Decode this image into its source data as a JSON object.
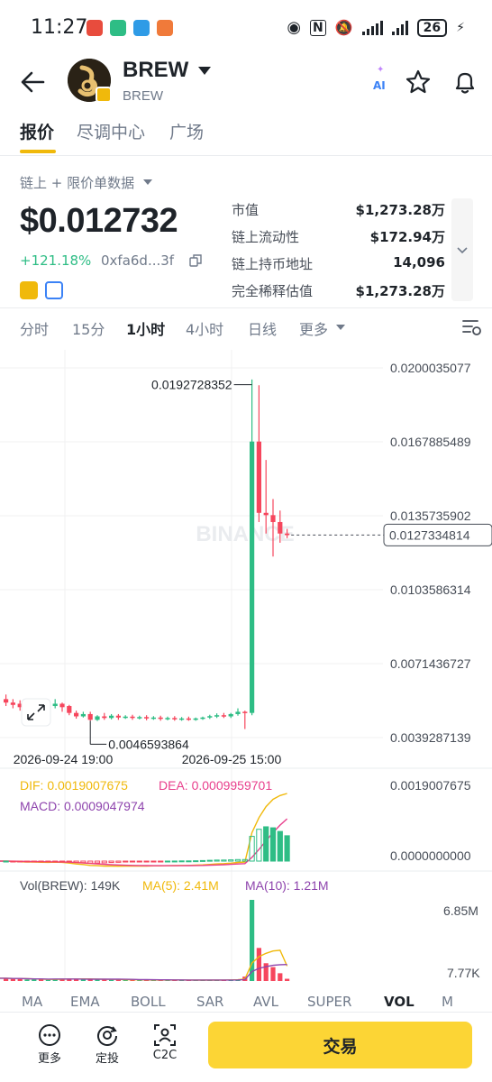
{
  "status_bar": {
    "time": "11:27",
    "battery": "26"
  },
  "header": {
    "title": "BREW",
    "subtitle": "BREW",
    "ai_label": "AI"
  },
  "tabs": [
    {
      "label": "报价"
    },
    {
      "label": "尽调中心"
    },
    {
      "label": "广场"
    }
  ],
  "info": {
    "data_source": "链上 + 限价单数据",
    "price": "$0.012732",
    "change": "+121.18%",
    "address": "0xfa6d...3f",
    "stats": [
      {
        "label": "市值",
        "value": "$1,273.28万"
      },
      {
        "label": "链上流动性",
        "value": "$172.94万"
      },
      {
        "label": "链上持币地址",
        "value": "14,096"
      },
      {
        "label": "完全稀释估值",
        "value": "$1,273.28万"
      }
    ]
  },
  "intervals": [
    {
      "label": "分时"
    },
    {
      "label": "15分"
    },
    {
      "label": "1小时"
    },
    {
      "label": "4小时"
    },
    {
      "label": "日线"
    },
    {
      "label": "更多"
    }
  ],
  "chart_data": {
    "type": "candlestick",
    "y_axis": [
      "0.0200035077",
      "0.0167885489",
      "0.0135735902",
      "0.0103586314",
      "0.0071436727",
      "0.0039287139"
    ],
    "ylim": [
      0.0039287139,
      0.0200035077
    ],
    "current_price_label": "0.0127334814",
    "current_price": 0.0127334814,
    "high_label": "0.0192728352",
    "high": 0.0192728352,
    "low_label": "0.0046593864",
    "low": 0.0046593864,
    "x_labels": [
      "2026-09-24 19:00",
      "2026-09-25 15:00"
    ],
    "watermark": "BINANCE",
    "candles": [
      {
        "o": 0.0056,
        "h": 0.0058,
        "c": 0.00545,
        "l": 0.0053
      },
      {
        "o": 0.00545,
        "h": 0.0056,
        "c": 0.00535,
        "l": 0.0052
      },
      {
        "o": 0.0054,
        "h": 0.00555,
        "c": 0.00525,
        "l": 0.0051
      },
      {
        "o": 0.00525,
        "h": 0.0054,
        "c": 0.0053,
        "l": 0.00515
      },
      {
        "o": 0.0053,
        "h": 0.0055,
        "c": 0.00535,
        "l": 0.0052
      },
      {
        "o": 0.00535,
        "h": 0.00545,
        "c": 0.00525,
        "l": 0.00515
      },
      {
        "o": 0.00525,
        "h": 0.00535,
        "c": 0.0053,
        "l": 0.00515
      },
      {
        "o": 0.0053,
        "h": 0.0056,
        "c": 0.0054,
        "l": 0.0052
      },
      {
        "o": 0.0054,
        "h": 0.00545,
        "c": 0.00525,
        "l": 0.00505
      },
      {
        "o": 0.0053,
        "h": 0.00535,
        "c": 0.005,
        "l": 0.0049
      },
      {
        "o": 0.005,
        "h": 0.0051,
        "c": 0.00485,
        "l": 0.00475
      },
      {
        "o": 0.00485,
        "h": 0.00505,
        "c": 0.00495,
        "l": 0.0048
      },
      {
        "o": 0.00495,
        "h": 0.00505,
        "c": 0.0047,
        "l": 0.00466
      },
      {
        "o": 0.0047,
        "h": 0.0049,
        "c": 0.00485,
        "l": 0.00465
      },
      {
        "o": 0.00485,
        "h": 0.005,
        "c": 0.00478,
        "l": 0.0047
      },
      {
        "o": 0.00478,
        "h": 0.00495,
        "c": 0.00488,
        "l": 0.00472
      },
      {
        "o": 0.00488,
        "h": 0.00495,
        "c": 0.0048,
        "l": 0.0047
      },
      {
        "o": 0.0048,
        "h": 0.0049,
        "c": 0.00484,
        "l": 0.00474
      },
      {
        "o": 0.00484,
        "h": 0.00492,
        "c": 0.00478,
        "l": 0.0047
      },
      {
        "o": 0.00478,
        "h": 0.00488,
        "c": 0.00482,
        "l": 0.00472
      },
      {
        "o": 0.00482,
        "h": 0.0049,
        "c": 0.00476,
        "l": 0.00468
      },
      {
        "o": 0.00476,
        "h": 0.00486,
        "c": 0.0048,
        "l": 0.0047
      },
      {
        "o": 0.0048,
        "h": 0.00488,
        "c": 0.00474,
        "l": 0.00466
      },
      {
        "o": 0.00474,
        "h": 0.00484,
        "c": 0.00478,
        "l": 0.00468
      },
      {
        "o": 0.00478,
        "h": 0.00486,
        "c": 0.00472,
        "l": 0.00466
      },
      {
        "o": 0.00472,
        "h": 0.00482,
        "c": 0.00476,
        "l": 0.00466
      },
      {
        "o": 0.00476,
        "h": 0.00484,
        "c": 0.0047,
        "l": 0.00466
      },
      {
        "o": 0.0047,
        "h": 0.0048,
        "c": 0.00476,
        "l": 0.00466
      },
      {
        "o": 0.00476,
        "h": 0.00484,
        "c": 0.0048,
        "l": 0.0047
      },
      {
        "o": 0.0048,
        "h": 0.00492,
        "c": 0.00486,
        "l": 0.00474
      },
      {
        "o": 0.00486,
        "h": 0.00498,
        "c": 0.0049,
        "l": 0.00478
      },
      {
        "o": 0.0049,
        "h": 0.005,
        "c": 0.00485,
        "l": 0.00478
      },
      {
        "o": 0.00485,
        "h": 0.005,
        "c": 0.00495,
        "l": 0.00478
      },
      {
        "o": 0.00495,
        "h": 0.0052,
        "c": 0.00505,
        "l": 0.00488
      },
      {
        "o": 0.00505,
        "h": 0.0051,
        "c": 0.005,
        "l": 0.0043
      },
      {
        "o": 0.005,
        "h": 0.0195,
        "c": 0.0168,
        "l": 0.0049
      },
      {
        "o": 0.0168,
        "h": 0.01925,
        "c": 0.0137,
        "l": 0.0133
      },
      {
        "o": 0.0137,
        "h": 0.016,
        "c": 0.0136,
        "l": 0.0128
      },
      {
        "o": 0.0136,
        "h": 0.0143,
        "c": 0.0133,
        "l": 0.0118
      },
      {
        "o": 0.0133,
        "h": 0.0138,
        "c": 0.0128,
        "l": 0.0124
      },
      {
        "o": 0.0128,
        "h": 0.013,
        "c": 0.01273,
        "l": 0.0126
      }
    ]
  },
  "macd": {
    "dif_label": "DIF: 0.0019007675",
    "dea_label": "DEA: 0.0009959701",
    "macd_label": "MACD: 0.0009047974",
    "axis_top": "0.0019007675",
    "axis_zero": "0.0000000000"
  },
  "volume": {
    "vol_label": "Vol(BREW): 149K",
    "ma5_label": "MA(5): 2.41M",
    "ma10_label": "MA(10): 1.21M",
    "axis_top": "6.85M",
    "axis_bottom": "7.77K"
  },
  "indicator_tabs": [
    {
      "label": "MA"
    },
    {
      "label": "EMA"
    },
    {
      "label": "BOLL"
    },
    {
      "label": "SAR"
    },
    {
      "label": "AVL"
    },
    {
      "label": "SUPER"
    },
    {
      "label": "VOL"
    },
    {
      "label": "M"
    }
  ],
  "bottom_bar": {
    "more_label": "更多",
    "dca_label": "定投",
    "c2c_label": "C2C",
    "trade_label": "交易"
  },
  "colors": {
    "up": "#2ebd85",
    "down": "#f6465d",
    "accent": "#f0b90b",
    "dif": "#f0b90b",
    "dea": "#e83e8c",
    "macd": "#8e44ad",
    "ma5": "#f0b90b",
    "ma10": "#8e44ad"
  }
}
